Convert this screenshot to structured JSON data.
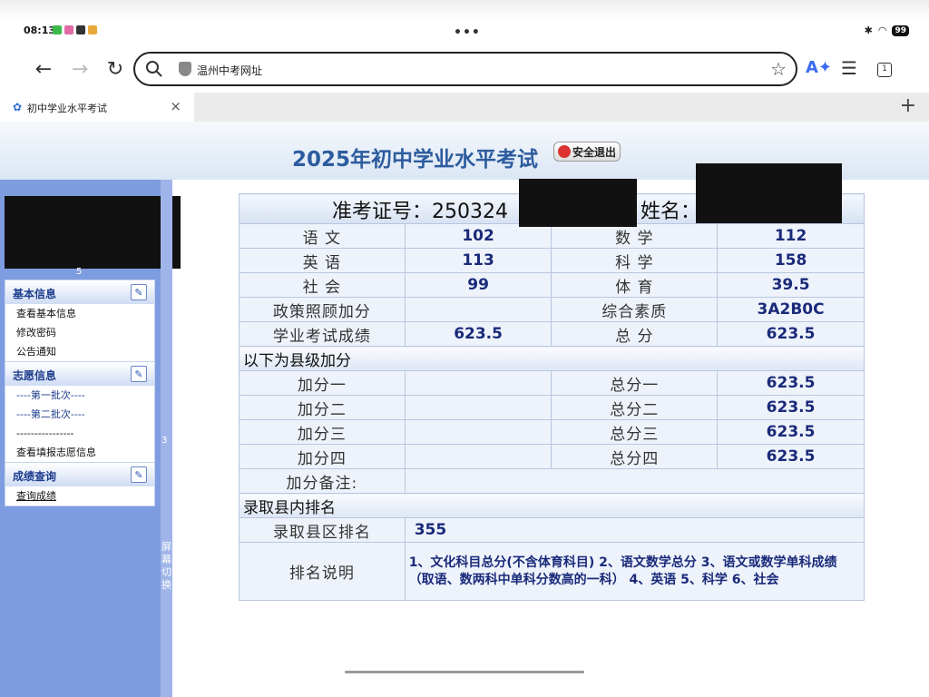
{
  "status": {
    "time": "08:13",
    "battery": "99",
    "dots": "•••"
  },
  "browser": {
    "url": "温州中考网址",
    "tab_title": "初中学业水平考试",
    "tab_count": "1"
  },
  "header": {
    "title": "2025年初中学业水平考试",
    "logout": "安全退出"
  },
  "sidebar": {
    "num_5": "5",
    "split_num": "3",
    "split_label": "屏幕切换",
    "groups": [
      {
        "title": "基本信息",
        "items": [
          "查看基本信息",
          "修改密码",
          "公告通知"
        ]
      },
      {
        "title": "志愿信息",
        "items": [
          "----第一批次----",
          "----第二批次----",
          "----------------",
          "查看填报志愿信息"
        ]
      },
      {
        "title": "成绩查询",
        "items": [
          "查询成绩"
        ]
      }
    ]
  },
  "result": {
    "exam_no_label": "准考证号：250324",
    "name_label": "姓名：",
    "rows": [
      {
        "l1": "语 文",
        "v1": "102",
        "l2": "数 学",
        "v2": "112"
      },
      {
        "l1": "英 语",
        "v1": "113",
        "l2": "科 学",
        "v2": "158"
      },
      {
        "l1": "社 会",
        "v1": "99",
        "l2": "体 育",
        "v2": "39.5"
      },
      {
        "l1": "政策照顾加分",
        "v1": "",
        "l2": "综合素质",
        "v2": "3A2B0C"
      },
      {
        "l1": "学业考试成绩",
        "v1": "623.5",
        "l2": "总 分",
        "v2": "623.5"
      }
    ],
    "bonus_section": "以下为县级加分",
    "bonus_rows": [
      {
        "l1": "加分一",
        "v1": "",
        "l2": "总分一",
        "v2": "623.5"
      },
      {
        "l1": "加分二",
        "v1": "",
        "l2": "总分二",
        "v2": "623.5"
      },
      {
        "l1": "加分三",
        "v1": "",
        "l2": "总分三",
        "v2": "623.5"
      },
      {
        "l1": "加分四",
        "v1": "",
        "l2": "总分四",
        "v2": "623.5"
      }
    ],
    "bonus_note_label": "加分备注:",
    "bonus_note_value": "",
    "rank_section": "录取县内排名",
    "rank_label": "录取县区排名",
    "rank_value": "355",
    "rank_desc_label": "排名说明",
    "rank_desc": "1、文化科目总分(不含体育科目) 2、语文数学总分 3、语文或数学单科成绩（取语、数两科中单科分数高的一科） 4、英语 5、科学 6、社会"
  }
}
